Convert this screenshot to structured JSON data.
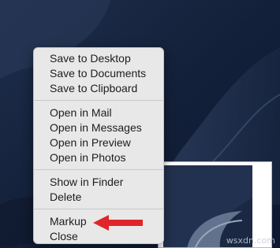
{
  "menu": {
    "groups": [
      {
        "items": [
          "Save to Desktop",
          "Save to Documents",
          "Save to Clipboard"
        ]
      },
      {
        "items": [
          "Open in Mail",
          "Open in Messages",
          "Open in Preview",
          "Open in Photos"
        ]
      },
      {
        "items": [
          "Show in Finder",
          "Delete"
        ]
      },
      {
        "items": [
          "Markup",
          "Close"
        ]
      }
    ]
  },
  "annotation": {
    "arrow_color": "#e0252a",
    "points_to": "Markup"
  },
  "watermark": "wsxdn.com",
  "colors": {
    "desktop": "#16223a",
    "menu_bg": "#e9e8e8",
    "menu_text": "#1d1d1d"
  }
}
